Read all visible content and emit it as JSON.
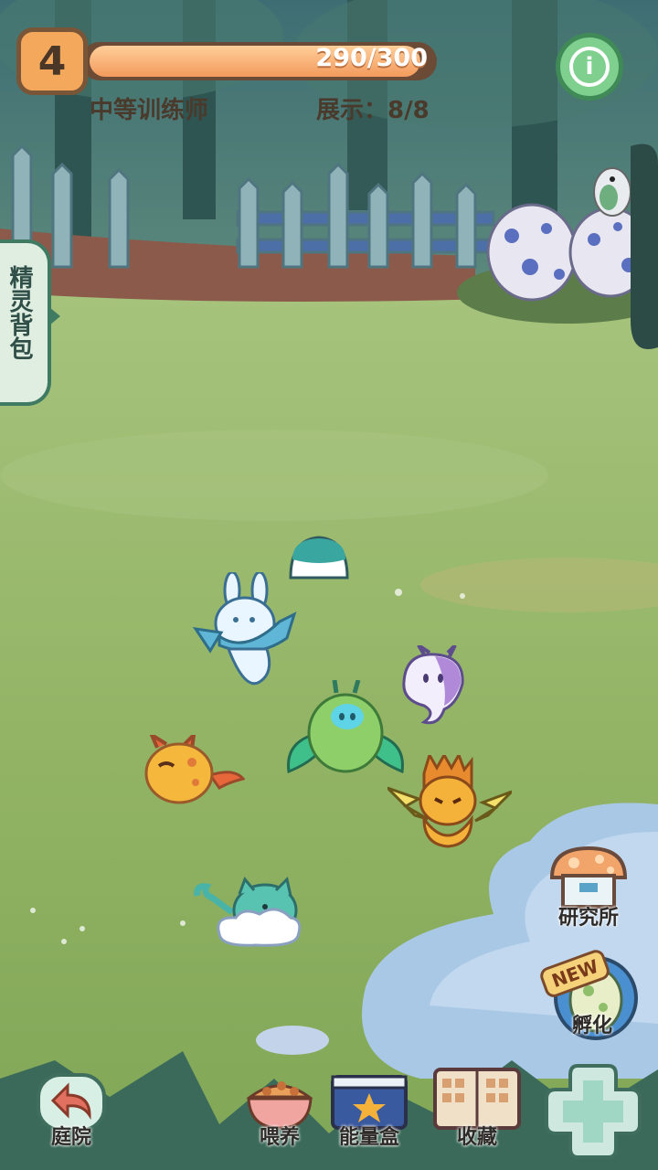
{
  "hud": {
    "level": "4",
    "xp_text": "290/300",
    "xp_fraction": 0.9667,
    "trainer_title": "中等训练师",
    "display_label": "展示：8/8",
    "info_icon": "info-icon"
  },
  "side": {
    "bag_label": "精灵背包"
  },
  "buttons": {
    "lab": "研究所",
    "hatch": "孵化",
    "hatch_badge": "NEW",
    "yard": "庭院",
    "feed": "喂养",
    "energy_box": "能量盒",
    "collection": "收藏"
  },
  "creatures": [
    "blue-bunny",
    "green-fluff",
    "purple-ghost",
    "orange-fire-bird",
    "yellow-thunder-cat",
    "cloud-cat",
    "teal-slime"
  ],
  "colors": {
    "grass": "#8fb264",
    "xp_fill": "#f39a5c",
    "info": "#7fcf8f"
  }
}
